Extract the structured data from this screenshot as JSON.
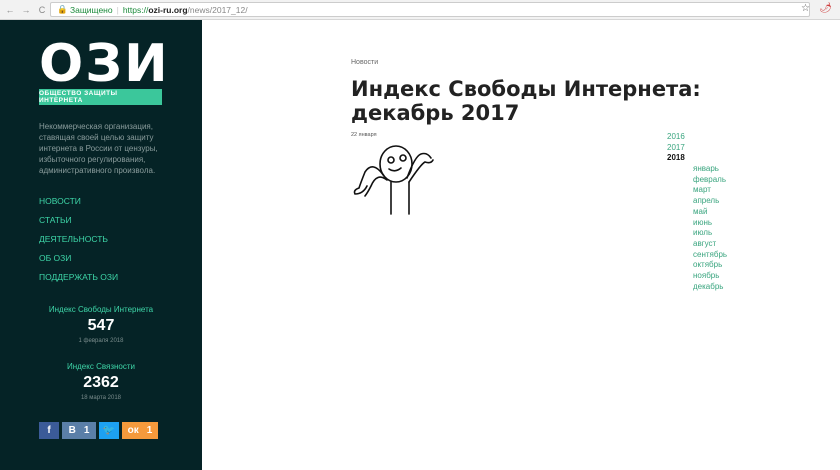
{
  "browser": {
    "secure_label": "Защищено",
    "url_scheme": "https://",
    "url_host": "ozi-ru.org",
    "url_path": "/news/2017_12/"
  },
  "sidebar": {
    "logo": "ОЗИ",
    "tagline": "ОБЩЕСТВО ЗАЩИТЫ ИНТЕРНЕТА",
    "description": "Некоммерческая организация, ставящая своей целью защиту интернета в России от цензуры, избыточного регулирования, административного произвола.",
    "menu": [
      "НОВОСТИ",
      "СТАТЬИ",
      "ДЕЯТЕЛЬНОСТЬ",
      "ОБ ОЗИ",
      "ПОДДЕРЖАТЬ ОЗИ"
    ],
    "indices": [
      {
        "label": "Индекс Свободы Интернета",
        "value": "547",
        "date": "1 февраля 2018"
      },
      {
        "label": "Индекс Связности",
        "value": "2362",
        "date": "18 марта 2018"
      }
    ],
    "social": {
      "facebook": "f",
      "vk": "В",
      "vk_count": "1",
      "twitter": "🐦",
      "ok": "ок",
      "ok_count": "1"
    }
  },
  "main": {
    "breadcrumb": "Новости",
    "title": "Индекс Свободы Интернета: декабрь 2017",
    "date": "22 января",
    "years": [
      "2016",
      "2017"
    ],
    "current_year": "2018",
    "months": [
      "январь",
      "февраль",
      "март",
      "апрель",
      "май",
      "июнь",
      "июль",
      "август",
      "сентябрь",
      "октябрь",
      "ноябрь",
      "декабрь"
    ]
  },
  "colors": {
    "sidebar": "#052326",
    "accent": "#3ed6a8",
    "link": "#3aa57f"
  }
}
